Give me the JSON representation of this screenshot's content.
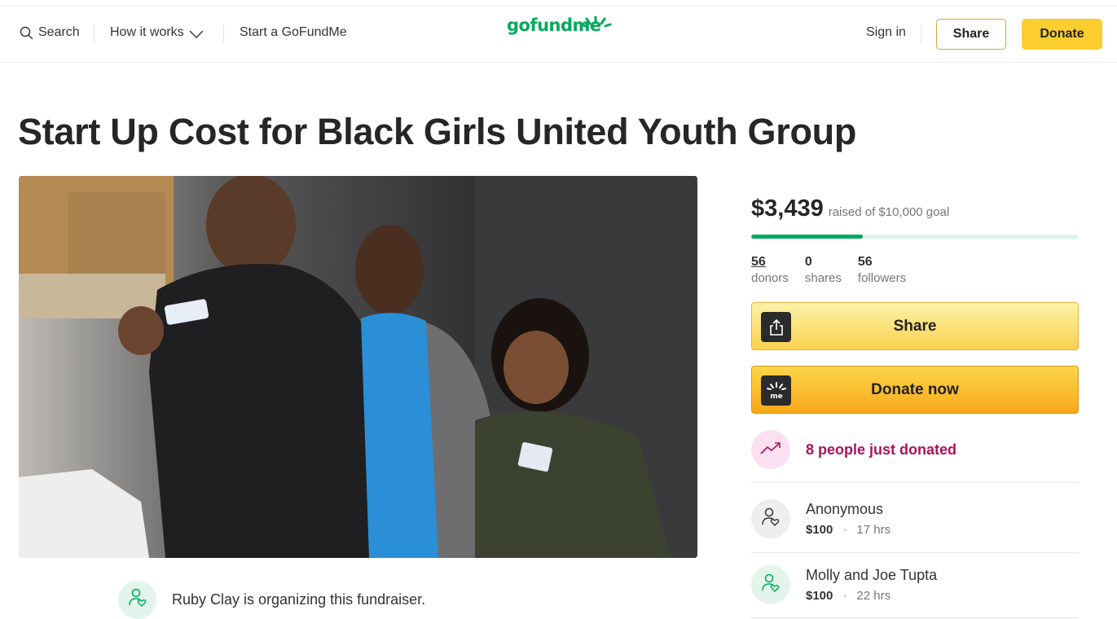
{
  "nav": {
    "search_label": "Search",
    "how_it_works_label": "How it works",
    "start_label": "Start a GoFundMe",
    "logo_text": "gofundme",
    "sign_in_label": "Sign in",
    "share_label": "Share",
    "donate_label": "Donate"
  },
  "campaign": {
    "title": "Start Up Cost for Black Girls United Youth Group",
    "organizer_text": "Ruby Clay is organizing this fundraiser."
  },
  "sidebar": {
    "raised_amount": "$3,439",
    "raised_goal_text": "raised of $10,000 goal",
    "progress_fraction": 0.34,
    "stats": [
      {
        "value": "56",
        "label": "donors"
      },
      {
        "value": "0",
        "label": "shares"
      },
      {
        "value": "56",
        "label": "followers"
      }
    ],
    "share_button_label": "Share",
    "donate_button_label": "Donate now",
    "trend_text": "8 people just donated",
    "donations": [
      {
        "name": "Anonymous",
        "amount": "$100",
        "time": "17 hrs"
      },
      {
        "name": "Molly and Joe Tupta",
        "amount": "$100",
        "time": "22 hrs"
      }
    ]
  },
  "colors": {
    "brand_green": "#02a95c",
    "donate_yellow": "#fbcd2e",
    "trend_magenta": "#a8125e"
  }
}
